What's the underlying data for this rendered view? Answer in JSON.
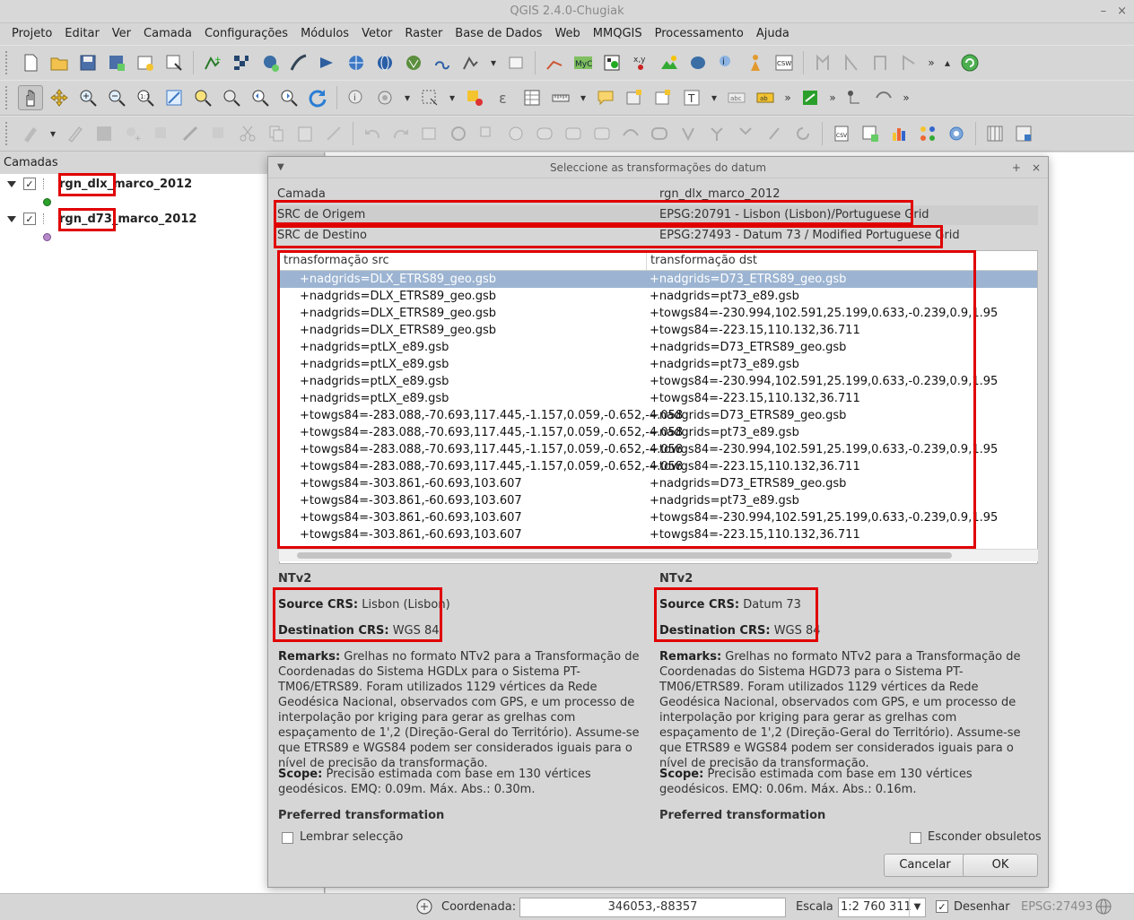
{
  "window": {
    "title": "QGIS 2.4.0-Chugiak",
    "controls": [
      "–",
      "×"
    ]
  },
  "menubar": [
    "Projeto",
    "Editar",
    "Ver",
    "Camada",
    "Configurações",
    "Módulos",
    "Vetor",
    "Raster",
    "Base de Dados",
    "Web",
    "MMQGIS",
    "Processamento",
    "Ajuda"
  ],
  "toolbar_overflow": "»",
  "layers_panel": {
    "title": "Camadas",
    "layers": [
      {
        "name": "rgn_dlx_marco_2012",
        "checked": "✓",
        "symbol_color": "#2aa02a"
      },
      {
        "name": "rgn_d73_marco_2012",
        "checked": "✓",
        "symbol_color": "#b58ac9"
      }
    ]
  },
  "dialog": {
    "title": "Seleccione as transformações do datum",
    "title_controls": [
      "+",
      "×"
    ],
    "menu_marker": "▼",
    "layer_label": "Camada",
    "layer_value": "rgn_dlx_marco_2012",
    "src_label": "SRC de Origem",
    "src_value": "EPSG:20791 - Lisbon (Lisbon)/Portuguese Grid",
    "dst_label": "SRC de Destino",
    "dst_value": "EPSG:27493 - Datum 73 / Modified Portuguese Grid",
    "table": {
      "headers": [
        "trnasformação src",
        "transformação dst"
      ],
      "rows": [
        [
          "+nadgrids=DLX_ETRS89_geo.gsb",
          "+nadgrids=D73_ETRS89_geo.gsb"
        ],
        [
          "+nadgrids=DLX_ETRS89_geo.gsb",
          "+nadgrids=pt73_e89.gsb"
        ],
        [
          "+nadgrids=DLX_ETRS89_geo.gsb",
          "+towgs84=-230.994,102.591,25.199,0.633,-0.239,0.9,1.95"
        ],
        [
          "+nadgrids=DLX_ETRS89_geo.gsb",
          "+towgs84=-223.15,110.132,36.711"
        ],
        [
          "+nadgrids=ptLX_e89.gsb",
          "+nadgrids=D73_ETRS89_geo.gsb"
        ],
        [
          "+nadgrids=ptLX_e89.gsb",
          "+nadgrids=pt73_e89.gsb"
        ],
        [
          "+nadgrids=ptLX_e89.gsb",
          "+towgs84=-230.994,102.591,25.199,0.633,-0.239,0.9,1.95"
        ],
        [
          "+nadgrids=ptLX_e89.gsb",
          "+towgs84=-223.15,110.132,36.711"
        ],
        [
          "+towgs84=-283.088,-70.693,117.445,-1.157,0.059,-0.652,-4.058",
          "+nadgrids=D73_ETRS89_geo.gsb"
        ],
        [
          "+towgs84=-283.088,-70.693,117.445,-1.157,0.059,-0.652,-4.058",
          "+nadgrids=pt73_e89.gsb"
        ],
        [
          "+towgs84=-283.088,-70.693,117.445,-1.157,0.059,-0.652,-4.058",
          "+towgs84=-230.994,102.591,25.199,0.633,-0.239,0.9,1.95"
        ],
        [
          "+towgs84=-283.088,-70.693,117.445,-1.157,0.059,-0.652,-4.058",
          "+towgs84=-223.15,110.132,36.711"
        ],
        [
          "+towgs84=-303.861,-60.693,103.607",
          "+nadgrids=D73_ETRS89_geo.gsb"
        ],
        [
          "+towgs84=-303.861,-60.693,103.607",
          "+nadgrids=pt73_e89.gsb"
        ],
        [
          "+towgs84=-303.861,-60.693,103.607",
          "+towgs84=-230.994,102.591,25.199,0.633,-0.239,0.9,1.95"
        ],
        [
          "+towgs84=-303.861,-60.693,103.607",
          "+towgs84=-223.15,110.132,36.711"
        ]
      ]
    },
    "left_info": {
      "heading": "NTv2",
      "source_label": "Source CRS:",
      "source_value": "Lisbon (Lisbon)",
      "dest_label": "Destination CRS:",
      "dest_value": "WGS 84",
      "remarks_label": "Remarks:",
      "remarks_text": "Grelhas no formato NTv2 para a Transformação de Coordenadas do Sistema HGDLx para o Sistema PT-TM06/ETRS89. Foram utilizados 1129 vértices da Rede Geodésica Nacional, observados com GPS, e um processo de interpolação por kriging para gerar as grelhas com espaçamento de 1',2 (Direção-Geral do Território). Assume-se que ETRS89 e WGS84 podem ser considerados iguais para o nível de precisão da transformação.",
      "scope_label": "Scope:",
      "scope_text": "Precisão estimada com base em 130 vértices geodésicos. EMQ: 0.09m. Máx. Abs.: 0.30m.",
      "preferred": "Preferred transformation"
    },
    "right_info": {
      "heading": "NTv2",
      "source_label": "Source CRS:",
      "source_value": "Datum 73",
      "dest_label": "Destination CRS:",
      "dest_value": "WGS 84",
      "remarks_label": "Remarks:",
      "remarks_text": "Grelhas no formato NTv2 para a Transformação de Coordenadas do Sistema HGD73 para o Sistema PT-TM06/ETRS89. Foram utilizados 1129 vértices da Rede Geodésica Nacional, observados com GPS, e um processo de interpolação por kriging para gerar as grelhas com espaçamento de 1',2 (Direção-Geral do Território). Assume-se que ETRS89 e WGS84 podem ser considerados iguais para o nível de precisão da transformação.",
      "scope_label": "Scope:",
      "scope_text": "Precisão estimada com base em 130 vértices geodésicos. EMQ: 0.06m. Máx. Abs.: 0.16m.",
      "preferred": "Preferred transformation"
    },
    "remember_label": "Lembrar selecção",
    "hide_obsolete_label": "Esconder obsuletos",
    "cancel_label": "Cancelar",
    "ok_label": "OK"
  },
  "statusbar": {
    "coord_label": "Coordenada:",
    "coord_value": "346053,-88357",
    "scale_label": "Escala",
    "scale_value": "1:2 760 311",
    "scale_arrow": "▼",
    "render_label": "Desenhar",
    "render_checked": "✓",
    "crs": "EPSG:27493"
  },
  "annotation_color": "#e00000"
}
